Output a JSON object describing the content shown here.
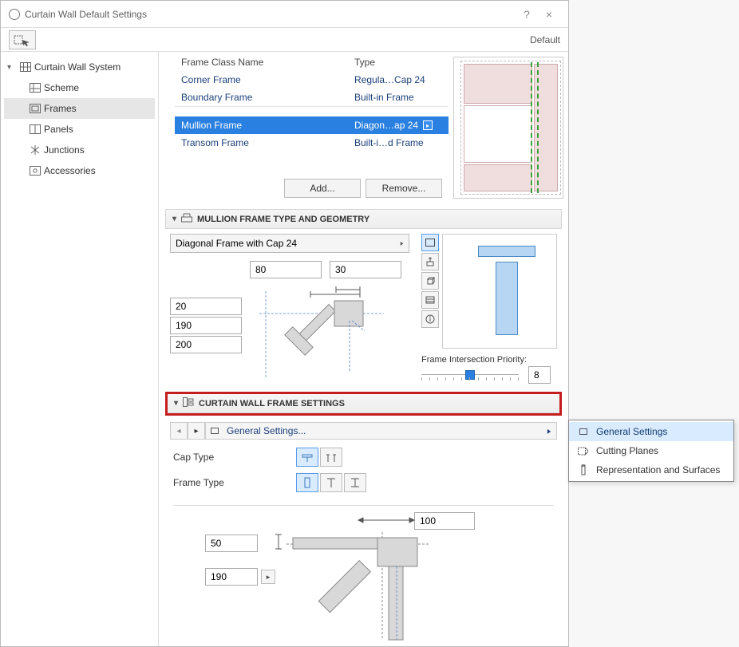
{
  "titlebar": {
    "title": "Curtain Wall Default Settings",
    "help": "?",
    "close": "×"
  },
  "toolbar": {
    "default": "Default"
  },
  "sidebar": {
    "root": "Curtain Wall System",
    "items": [
      "Scheme",
      "Frames",
      "Panels",
      "Junctions",
      "Accessories"
    ],
    "selected": 1
  },
  "frames_table": {
    "header": {
      "c1": "Frame Class Name",
      "c2": "Type"
    },
    "rows": [
      {
        "name": "Corner Frame",
        "type": "Regula…Cap 24"
      },
      {
        "name": "Boundary Frame",
        "type": "Built-in Frame"
      },
      {
        "name": "Mullion Frame",
        "type": "Diagon…ap 24",
        "selected": true
      },
      {
        "name": "Transom Frame",
        "type": "Built-i…d Frame"
      }
    ],
    "add_label": "Add...",
    "remove_label": "Remove..."
  },
  "section_geom": {
    "title": "MULLION FRAME TYPE AND GEOMETRY",
    "profile": "Diagonal Frame with Cap 24",
    "w": "80",
    "d": "30",
    "a": "20",
    "b": "190",
    "c": "200",
    "priority_label": "Frame Intersection Priority:",
    "priority_value": "8"
  },
  "section_frame": {
    "title": "CURTAIN WALL FRAME SETTINGS",
    "tab_label": "General Settings...",
    "cap_type_label": "Cap Type",
    "frame_type_label": "Frame Type",
    "v1": "50",
    "v2": "190",
    "v3": "100"
  },
  "popup": {
    "items": [
      "General Settings",
      "Cutting Planes",
      "Representation and Surfaces"
    ],
    "selected": 0
  }
}
